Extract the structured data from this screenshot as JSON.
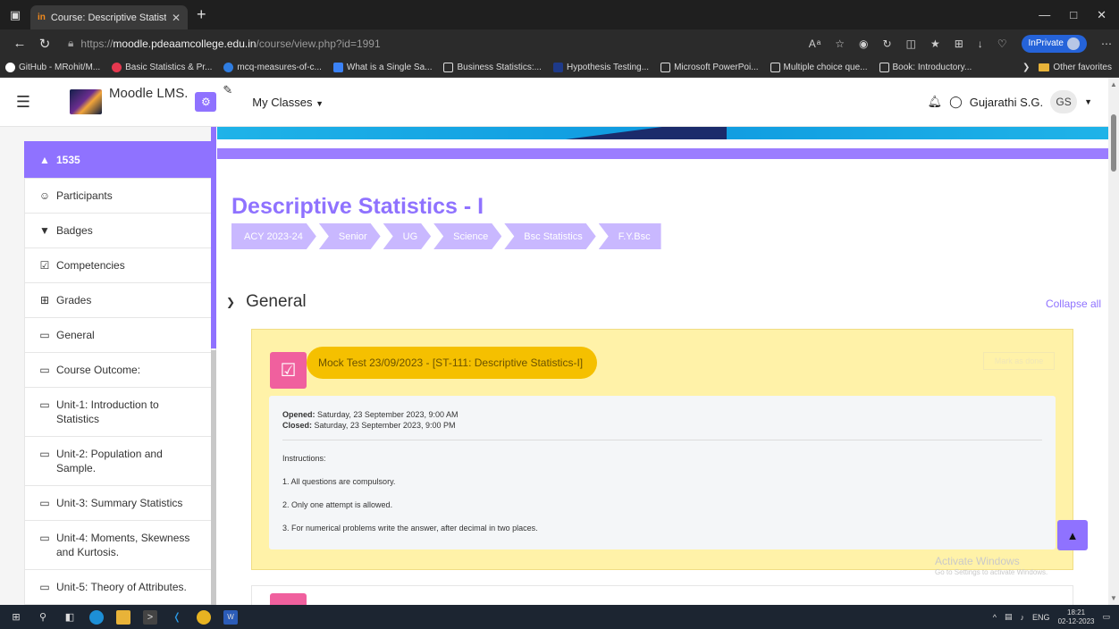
{
  "browser": {
    "tab_title": "Course: Descriptive Statistics - I",
    "tab_favicon": "in",
    "url_prefix": "https://",
    "url_host": "moodle.pdeaamcollege.edu.in",
    "url_path": "/course/view.php?id=1991",
    "inprivate_label": "InPrivate",
    "favorites": [
      {
        "label": "GitHub - MRohit/M...",
        "color": "#ffffff"
      },
      {
        "label": "Basic Statistics & Pr...",
        "color": "#e5384f"
      },
      {
        "label": "mcq-measures-of-c...",
        "color": "#2f7de1"
      },
      {
        "label": "What is a Single Sa...",
        "color": "#3b82f6"
      },
      {
        "label": "Business Statistics:...",
        "color": "#dddddd"
      },
      {
        "label": "Hypothesis Testing...",
        "color": "#1e3a8a"
      },
      {
        "label": "Microsoft PowerPoi...",
        "color": "#dddddd"
      },
      {
        "label": "Multiple choice que...",
        "color": "#dddddd"
      },
      {
        "label": "Book: Introductory...",
        "color": "#dddddd"
      }
    ],
    "other_favorites": "Other favorites"
  },
  "header": {
    "site_name": "Moodle LMS.",
    "my_classes": "My Classes",
    "user_name": "Gujarathi S.G.",
    "user_initials": "GS"
  },
  "drawer": {
    "course_id": "1535",
    "items": [
      {
        "label": "Participants",
        "icon": "users-icon",
        "glyph": "☺"
      },
      {
        "label": "Badges",
        "icon": "shield-icon",
        "glyph": "▼"
      },
      {
        "label": "Competencies",
        "icon": "check-square-icon",
        "glyph": "☑"
      },
      {
        "label": "Grades",
        "icon": "table-icon",
        "glyph": "⊞"
      },
      {
        "label": "General",
        "icon": "folder-icon",
        "glyph": "▭"
      },
      {
        "label": "Course Outcome:",
        "icon": "folder-icon",
        "glyph": "▭"
      },
      {
        "label": "Unit-1: Introduction to Statistics",
        "icon": "folder-icon",
        "glyph": "▭"
      },
      {
        "label": "Unit-2: Population and Sample.",
        "icon": "folder-icon",
        "glyph": "▭"
      },
      {
        "label": "Unit-3: Summary Statistics",
        "icon": "folder-icon",
        "glyph": "▭"
      },
      {
        "label": "Unit-4: Moments, Skewness and Kurtosis.",
        "icon": "folder-icon",
        "glyph": "▭"
      },
      {
        "label": "Unit-5: Theory of Attributes.",
        "icon": "folder-icon",
        "glyph": "▭"
      }
    ]
  },
  "course": {
    "title": "Descriptive Statistics - I",
    "breadcrumb": [
      "ACY 2023-24",
      "Senior",
      "UG",
      "Science",
      "Bsc Statistics",
      "F.Y.Bsc"
    ],
    "section_title": "General",
    "collapse_all": "Collapse all"
  },
  "activity": {
    "name": "Mock Test 23/09/2023 - [ST-111: Descriptive Statistics-I]",
    "mark_done": "Mark as done",
    "opened_label": "Opened:",
    "opened_value": "Saturday, 23 September 2023, 9:00 AM",
    "closed_label": "Closed:",
    "closed_value": "Saturday, 23 September 2023, 9:00 PM",
    "instructions_heading": "Instructions:",
    "instructions": [
      "1. All questions are compulsory.",
      "2. Only one attempt is allowed.",
      "3. For numerical problems write the answer, after decimal in two places."
    ]
  },
  "watermark": {
    "line1": "Activate Windows",
    "line2": "Go to Settings to activate Windows."
  },
  "taskbar": {
    "lang": "ENG",
    "time": "18:21",
    "date": "02-12-2023"
  },
  "colors": {
    "accent": "#8f72ff",
    "activity_bg": "#fff2a8",
    "activity_pill": "#f5c000",
    "quiz_icon": "#f0609e"
  }
}
